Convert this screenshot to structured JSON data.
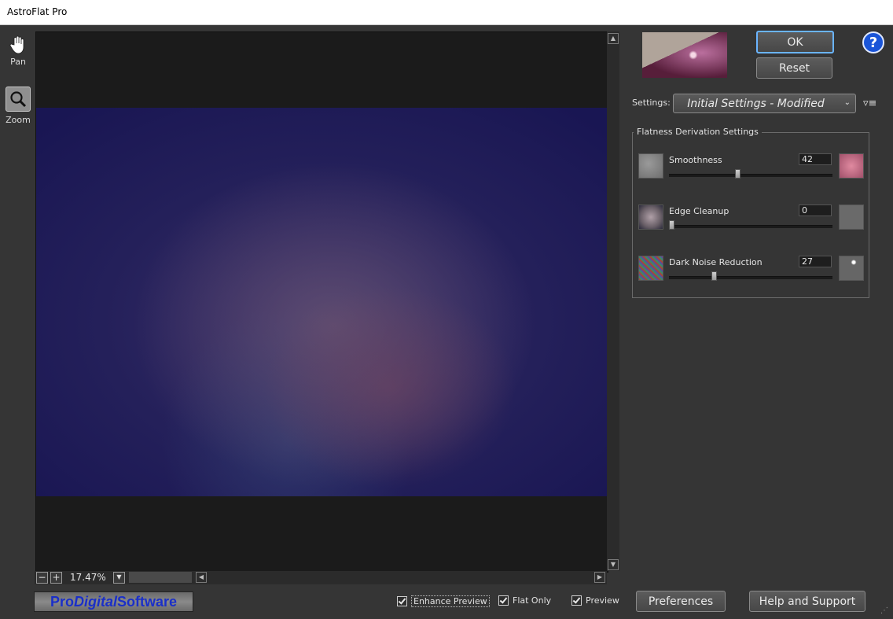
{
  "window": {
    "title": "AstroFlat Pro"
  },
  "tools": {
    "pan_label": "Pan",
    "zoom_label": "Zoom"
  },
  "preview": {
    "zoom_level": "17.47%"
  },
  "footer": {
    "logo_pro": "Pro",
    "logo_digital": "Digital",
    "logo_software": " Software",
    "enhance_preview_label": "Enhance Preview",
    "flat_only_label": "Flat Only",
    "preview_label": "Preview",
    "preferences_label": "Preferences",
    "help_label": "Help and Support"
  },
  "controls": {
    "ok_label": "OK",
    "reset_label": "Reset",
    "help_glyph": "?"
  },
  "settings": {
    "label": "Settings:",
    "value": "Initial Settings - Modified"
  },
  "flatness": {
    "group_title": "Flatness Derivation Settings",
    "sliders": [
      {
        "label": "Smoothness",
        "value": "42"
      },
      {
        "label": "Edge Cleanup",
        "value": "0"
      },
      {
        "label": "Dark Noise Reduction",
        "value": "27"
      }
    ]
  },
  "colors": {
    "accent": "#6ab4ff",
    "logo_text": "#1a2fc8",
    "help_blue": "#1a55d8"
  }
}
